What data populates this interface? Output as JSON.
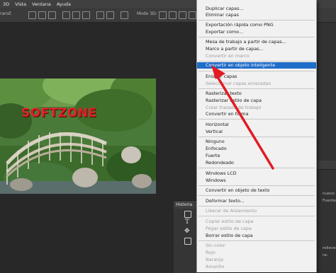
{
  "menubar": {
    "items": [
      "3D",
      "Vista",
      "Ventana",
      "Ayuda"
    ]
  },
  "options_bar": {
    "tab_label": "ransf.",
    "mode_label": "Modo 3D:"
  },
  "context_menu": {
    "items": [
      {
        "label": "Duplicar capas...",
        "state": "normal"
      },
      {
        "label": "Eliminar capas",
        "state": "normal"
      },
      {
        "label": "Exportación rápida como PNG",
        "state": "normal"
      },
      {
        "label": "Exportar como...",
        "state": "normal"
      },
      {
        "label": "Mesa de trabajo a partir de capas...",
        "state": "normal"
      },
      {
        "label": "Marco a partir de capas...",
        "state": "normal"
      },
      {
        "label": "Convertir en marco",
        "state": "disabled"
      },
      {
        "label": "Convertir en objeto inteligente",
        "state": "highlighted"
      },
      {
        "label": "Enlazar capas",
        "state": "normal"
      },
      {
        "label": "Seleccionar capas enlazadas",
        "state": "disabled"
      },
      {
        "label": "Rasterizar texto",
        "state": "normal"
      },
      {
        "label": "Rasterizar estilo de capa",
        "state": "normal"
      },
      {
        "label": "Crear trazado de trabajo",
        "state": "disabled"
      },
      {
        "label": "Convertir en forma",
        "state": "normal"
      },
      {
        "label": "Horizontal",
        "state": "normal"
      },
      {
        "label": "Vertical",
        "state": "normal"
      },
      {
        "label": "Ninguno",
        "state": "normal"
      },
      {
        "label": "Enfocado",
        "state": "normal"
      },
      {
        "label": "Fuerte",
        "state": "normal"
      },
      {
        "label": "Redondeado",
        "state": "normal"
      },
      {
        "label": "Windows LCD",
        "state": "normal"
      },
      {
        "label": "Windows",
        "state": "normal"
      },
      {
        "label": "Convertir en objeto de texto",
        "state": "normal"
      },
      {
        "label": "Deformar texto...",
        "state": "normal"
      },
      {
        "label": "Liberar de Aislamiento",
        "state": "disabled"
      },
      {
        "label": "Copiar estilo de capa",
        "state": "disabled"
      },
      {
        "label": "Pegar estilo de capa",
        "state": "disabled"
      },
      {
        "label": "Borrar estilo de capa",
        "state": "normal"
      },
      {
        "label": "Sin color",
        "state": "disabled"
      },
      {
        "label": "Rojo",
        "state": "disabled"
      },
      {
        "label": "Naranja",
        "state": "disabled"
      },
      {
        "label": "Amarillo",
        "state": "disabled"
      }
    ]
  },
  "image": {
    "watermark": "SOFTZONE"
  },
  "history_panel": {
    "title": "Historia"
  },
  "right_panel": {
    "labels": [
      "nuevo",
      "Fuente ",
      "relleve",
      "ra:"
    ]
  },
  "colors": {
    "highlight": "#1f6cc9",
    "arrow": "#e21b23",
    "menu_bg": "#f1f1f1"
  }
}
